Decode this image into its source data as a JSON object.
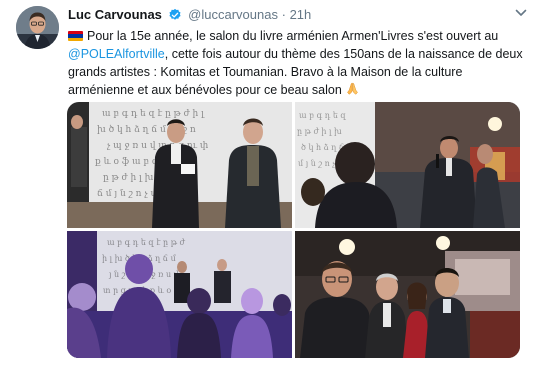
{
  "tweet": {
    "display_name": "Luc Carvounas",
    "handle": "@luccarvounas",
    "separator": "·",
    "timestamp": "21h",
    "text_part1": "Pour la 15e année, le salon du livre arménien Armen'Livres s'est ouvert au",
    "mention": "@POLEAlfortville",
    "text_part2": ", cette fois autour du thème des 150ans de la naissance de deux grands artistes :  Komitas et Toumanian. Bravo à la Maison de la culture arménienne et aux bénévoles pour ce beau salon",
    "flag_colors": [
      "#d90012",
      "#0033a0",
      "#f2a800"
    ]
  },
  "icons": {
    "avatar": "profile-photo",
    "verified": "verified-badge-icon",
    "chevron": "chevron-down-icon",
    "flag": "armenia-flag-emoji",
    "pray": "folded-hands-emoji"
  },
  "colors": {
    "link": "#1b95e0",
    "secondary_text": "#657786",
    "verified": "#1da1f2"
  }
}
